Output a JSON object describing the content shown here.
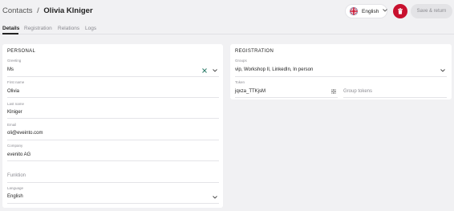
{
  "header": {
    "breadcrumb": "Contacts",
    "separator": "/",
    "title": "Olivia Klniger",
    "language_selector": {
      "value": "English",
      "flag_icon": "uk-flag-icon"
    },
    "delete_icon": "trash-icon",
    "save_label": "Save & return"
  },
  "tabs": [
    {
      "label": "Details",
      "active": true
    },
    {
      "label": "Registration",
      "active": false
    },
    {
      "label": "Relations",
      "active": false
    },
    {
      "label": "Logs",
      "active": false
    }
  ],
  "personal": {
    "title": "PERSONAL",
    "greeting": {
      "label": "Greeting",
      "value": "Ms"
    },
    "first_name": {
      "label": "First name",
      "value": "Olivia"
    },
    "last_name": {
      "label": "Last name",
      "value": "Klniger"
    },
    "email": {
      "label": "Email",
      "value": "oli@eveinto.com"
    },
    "company": {
      "label": "Company",
      "value": "evenito AG"
    },
    "function": {
      "placeholder": "Funktion"
    },
    "language": {
      "label": "Language",
      "value": "English"
    }
  },
  "registration": {
    "title": "REGISTRATION",
    "groups": {
      "label": "Groups",
      "value": "vip, Workshop II, LinkedIn, In person"
    },
    "token": {
      "label": "Token",
      "value": "jqxza_TTKjsM"
    },
    "group_tokens": {
      "placeholder": "Group tokens"
    }
  },
  "colors": {
    "background": "#f1f1f3",
    "card": "#ffffff",
    "delete": "#c8102e",
    "save_disabled": "#e3e3e6",
    "clear_icon": "#2e7d6b"
  }
}
